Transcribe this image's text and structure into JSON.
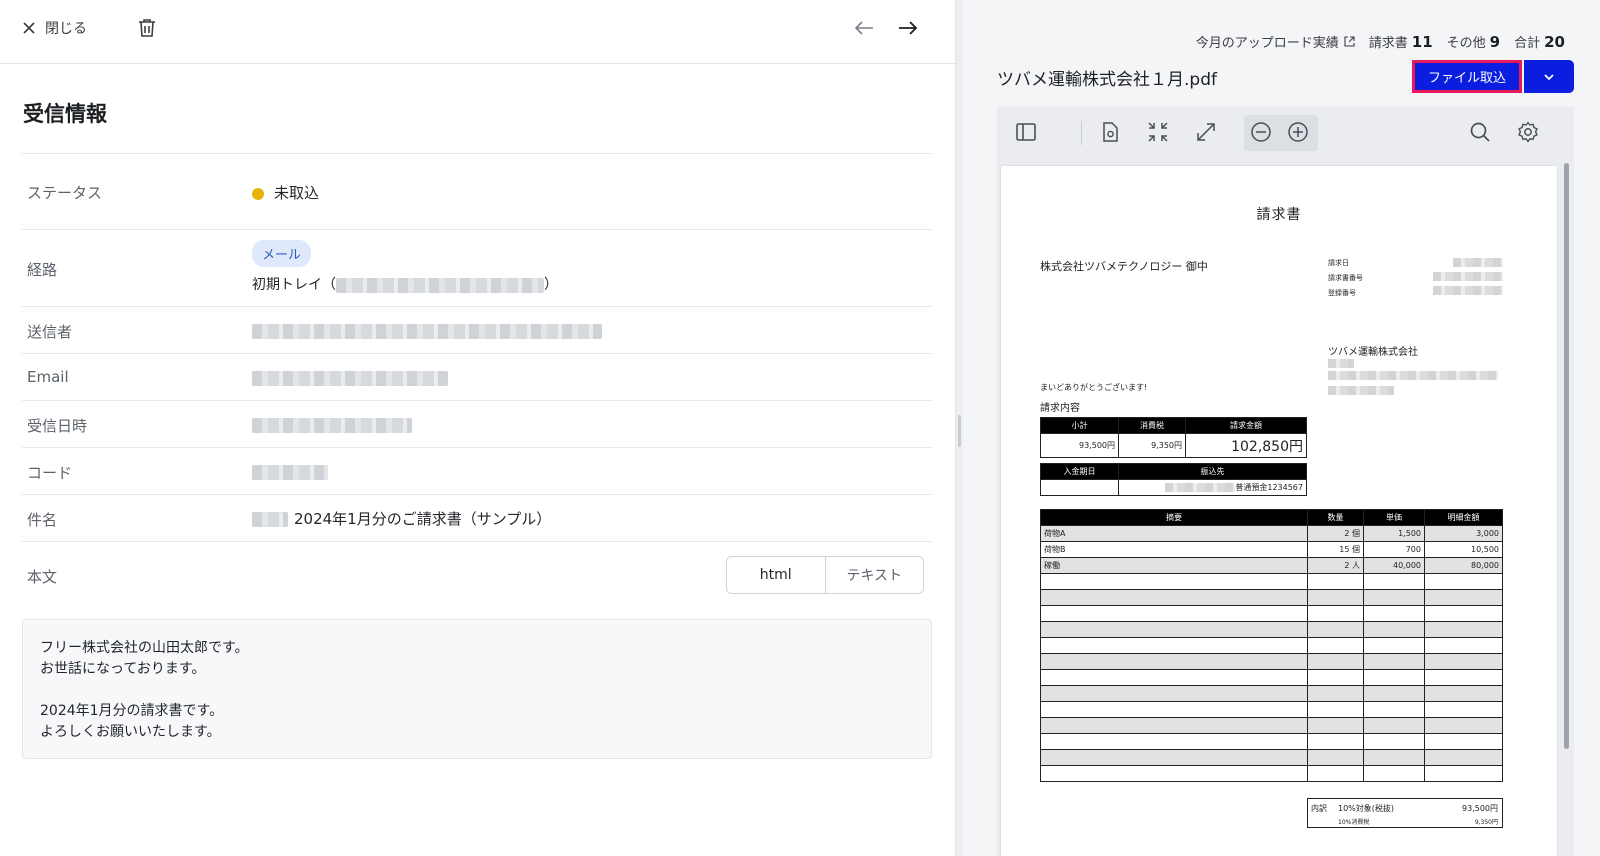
{
  "topbar": {
    "close_label": "閉じる"
  },
  "section": {
    "title": "受信情報"
  },
  "info": {
    "status_label": "ステータス",
    "status_value": "未取込",
    "route_label": "経路",
    "route_chip": "メール",
    "route_value_prefix": "初期トレイ（",
    "route_value_suffix": "）",
    "sender_label": "送信者",
    "email_label": "Email",
    "received_label": "受信日時",
    "code_label": "コード",
    "subject_label": "件名",
    "subject_value": "2024年1月分のご請求書（サンプル）",
    "body_label": "本文",
    "body_tabs": [
      "html",
      "テキスト"
    ]
  },
  "body_text": [
    "フリー株式会社の山田太郎です。",
    "お世話になっております。",
    "",
    "2024年1月分の請求書です。",
    "よろしくお願いいたします。"
  ],
  "summary": {
    "upload_link": "今月のアップロード実績",
    "invoice_label": "請求書",
    "invoice_count": "11",
    "other_label": "その他",
    "other_count": "9",
    "total_label": "合計",
    "total_count": "20"
  },
  "file": {
    "name": "ツバメ運輸株式会社１月.pdf",
    "import_label": "ファイル取込"
  },
  "colors": {
    "accent": "#0b1ee0",
    "highlight": "#e8185d",
    "status_dot": "#e8b20a"
  },
  "pdf": {
    "title": "請求書",
    "recipient": "株式会社ツバメテクノロジー 御中",
    "meta_labels": [
      "請求日",
      "請求書番号",
      "登録番号"
    ],
    "issuer": "ツバメ運輸株式会社",
    "greeting": "まいどありがとうございます!",
    "content_heading": "請求内容",
    "summary_headers": [
      "小計",
      "消費税",
      "請求金額"
    ],
    "summary_values": [
      "93,500円",
      "9,350円",
      "102,850円"
    ],
    "payment_headers": [
      "入金期日",
      "振込先"
    ],
    "payment_account_suffix": "普通預金1234567",
    "items_headers": [
      "摘要",
      "数量",
      "単価",
      "明細金額"
    ],
    "items": [
      {
        "desc": "荷物A",
        "qty": "2 個",
        "price": "1,500",
        "amount": "3,000"
      },
      {
        "desc": "荷物B",
        "qty": "15 個",
        "price": "700",
        "amount": "10,500"
      },
      {
        "desc": "稼働",
        "qty": "2 人",
        "price": "40,000",
        "amount": "80,000"
      }
    ],
    "breakdown_label": "内訳",
    "breakdown_target": "10%対象(税抜)",
    "breakdown_target_amount": "93,500円",
    "breakdown_tax": "10%消費税",
    "breakdown_tax_amount": "9,350円"
  }
}
